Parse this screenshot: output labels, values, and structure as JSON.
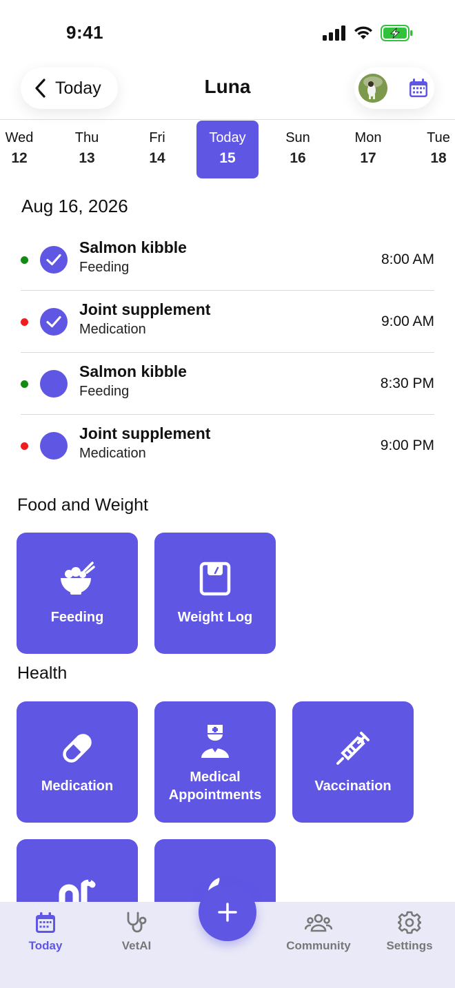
{
  "status_bar": {
    "time": "9:41"
  },
  "header": {
    "back_label": "Today",
    "title": "Luna"
  },
  "date_strip": {
    "days": [
      {
        "name": "Wed",
        "num": "12"
      },
      {
        "name": "Thu",
        "num": "13"
      },
      {
        "name": "Fri",
        "num": "14"
      },
      {
        "name": "Today",
        "num": "15",
        "active": true
      },
      {
        "name": "Sun",
        "num": "16"
      },
      {
        "name": "Mon",
        "num": "17"
      },
      {
        "name": "Tue",
        "num": "18"
      }
    ]
  },
  "date_heading": "Aug 16, 2026",
  "tasks": [
    {
      "title": "Salmon kibble",
      "category": "Feeding",
      "time": "8:00 AM",
      "done": true,
      "dot_color": "#138a12"
    },
    {
      "title": "Joint supplement",
      "category": "Medication",
      "time": "9:00 AM",
      "done": true,
      "dot_color": "#f01d1d"
    },
    {
      "title": "Salmon kibble",
      "category": "Feeding",
      "time": "8:30 PM",
      "done": false,
      "dot_color": "#138a12"
    },
    {
      "title": "Joint supplement",
      "category": "Medication",
      "time": "9:00 PM",
      "done": false,
      "dot_color": "#f01d1d"
    }
  ],
  "sections": {
    "food_weight": {
      "title": "Food and Weight",
      "tiles": [
        {
          "label": "Feeding",
          "icon": "bowl-icon"
        },
        {
          "label": "Weight Log",
          "icon": "scale-icon"
        }
      ]
    },
    "health": {
      "title": "Health",
      "tiles": [
        {
          "label": "Medication",
          "icon": "pill-icon"
        },
        {
          "label_line1": "Medical",
          "label_line2": "Appointments",
          "icon": "doctor-icon"
        },
        {
          "label": "Vaccination",
          "icon": "syringe-icon"
        },
        {
          "label": "",
          "icon": "worm-icon"
        },
        {
          "label": "",
          "icon": "flame-icon"
        }
      ]
    }
  },
  "tabbar": {
    "tabs": [
      {
        "label": "Today",
        "icon": "calendar-icon",
        "active": true
      },
      {
        "label": "VetAI",
        "icon": "stethoscope-icon"
      },
      {
        "label": "Community",
        "icon": "people-icon"
      },
      {
        "label": "Settings",
        "icon": "gear-icon"
      }
    ],
    "fab_icon": "plus-icon"
  },
  "colors": {
    "accent": "#5f56e4",
    "feeding_dot": "#138a12",
    "medication_dot": "#f01d1d",
    "tabbar_bg": "#e9e9f7"
  }
}
